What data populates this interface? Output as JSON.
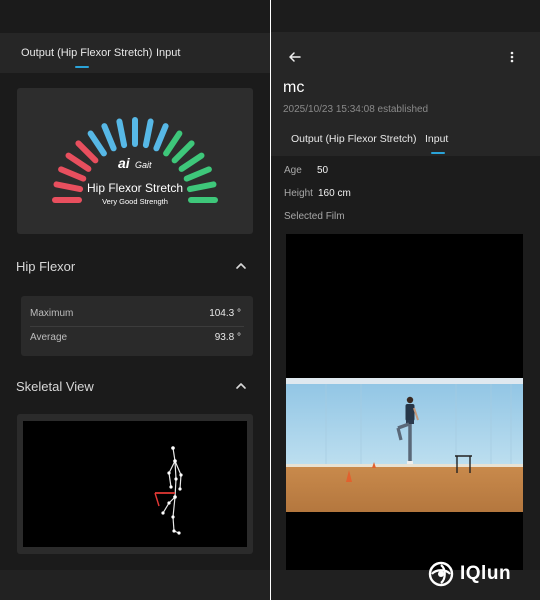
{
  "left": {
    "tabs": [
      {
        "label": "Output (Hip Flexor Stretch)",
        "active": true
      },
      {
        "label": "Input",
        "active": false
      }
    ],
    "gauge": {
      "brand_ai": "ai",
      "brand_gait": "Gait",
      "title": "Hip Flexor Stretch",
      "rating": "Very Good Strength",
      "segment_colors": [
        "#e84f5e",
        "#e84f5e",
        "#e84f5e",
        "#e84f5e",
        "#e84f5e",
        "#57b8e6",
        "#57b8e6",
        "#57b8e6",
        "#57b8e6",
        "#57b8e6",
        "#57b8e6",
        "#3ec77a",
        "#3ec77a",
        "#3ec77a",
        "#3ec77a",
        "#3ec77a",
        "#3ec77a"
      ]
    },
    "hip_flexor": {
      "title": "Hip Flexor",
      "maximum_label": "Maximum",
      "maximum_value": "104.3 °",
      "average_label": "Average",
      "average_value": "93.8 °"
    },
    "skeletal": {
      "title": "Skeletal View"
    }
  },
  "right": {
    "name": "mc",
    "established": "2025/10/23 15:34:08 established",
    "tabs": [
      {
        "label": "Output (Hip Flexor Stretch)",
        "active": false
      },
      {
        "label": "Input",
        "active": true
      }
    ],
    "age_label": "Age",
    "age_value": "50",
    "height_label": "Height",
    "height_value": "160 cm",
    "film_label": "Selected Film"
  },
  "watermark": {
    "text": "IQlun"
  },
  "colors": {
    "accent": "#2aa3d8",
    "pose_line": "#ffffff",
    "pose_highlight": "#e53935",
    "wall": "#a9d3ea",
    "floor": "#c88a50"
  }
}
